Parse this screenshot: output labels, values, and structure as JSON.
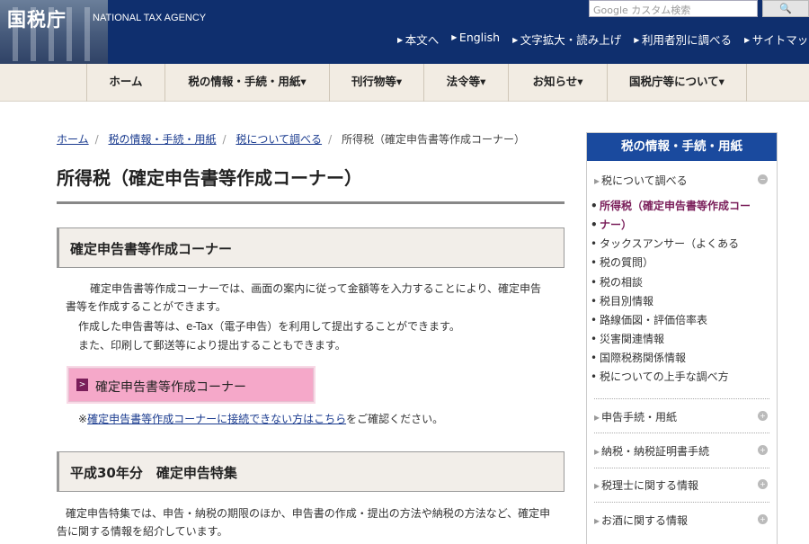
{
  "header": {
    "logo_text": "国税庁",
    "logo_en": "NATIONAL TAX AGENCY",
    "search_placeholder": "Google カスタム検索",
    "search_button_icon": "magnifier-icon",
    "util_links": [
      "本文へ",
      "English",
      "文字拡大・読み上げ",
      "利用者別に調べる",
      "サイトマップ"
    ]
  },
  "gnav": [
    "ホーム",
    "税の情報・手続・用紙",
    "刊行物等",
    "法令等",
    "お知らせ",
    "国税庁等について"
  ],
  "breadcrumb": {
    "links": [
      "ホーム",
      "税の情報・手続・用紙",
      "税について調べる"
    ],
    "current": "所得税（確定申告書等作成コーナー）"
  },
  "main": {
    "title": "所得税（確定申告書等作成コーナー）",
    "section1": {
      "heading": "確定申告書等作成コーナー",
      "para1_line1": "確定申告書等作成コーナーでは、画面の案内に従って金額等を入力することにより、確定申告",
      "para1_line2": "書等を作成することができます。",
      "para2": "作成した申告書等は、e-Tax（電子申告）を利用して提出することができます。",
      "para3": "また、印刷して郵送等により提出することもできます。",
      "cta_label": "確定申告書等作成コーナー",
      "note_prefix": "※",
      "note_link": "確定申告書等作成コーナーに接続できない方はこちら",
      "note_suffix": "をご確認ください。"
    },
    "section2": {
      "heading": "平成30年分　確定申告特集",
      "para_line1": "確定申告特集では、申告・納税の期限のほか、申告書の作成・提出の方法や納税の方法など、確定申",
      "para_line2": "告に関する情報を紹介しています。"
    }
  },
  "sidebar": {
    "heading": "税の情報・手続・用紙",
    "top_item": "税について調べる",
    "sub_items": [
      "所得税（確定申告書等作成コー",
      "ナー）",
      "タックスアンサー（よくある",
      "税の質問）",
      "税の相談",
      "税目別情報",
      "路線価図・評価倍率表",
      "災害関連情報",
      "国際税務関係情報",
      "税についての上手な調べ方"
    ],
    "items": [
      "申告手続・用紙",
      "納税・納税証明書手続",
      "税理士に関する情報",
      "お酒に関する情報"
    ]
  },
  "colors": {
    "header_bg": "#0f2f6e",
    "nav_bg": "#f2ece3",
    "side_head_bg": "#1a4a9e",
    "cta_bg": "#f5a8c9",
    "active_link": "#7a1e5a"
  }
}
